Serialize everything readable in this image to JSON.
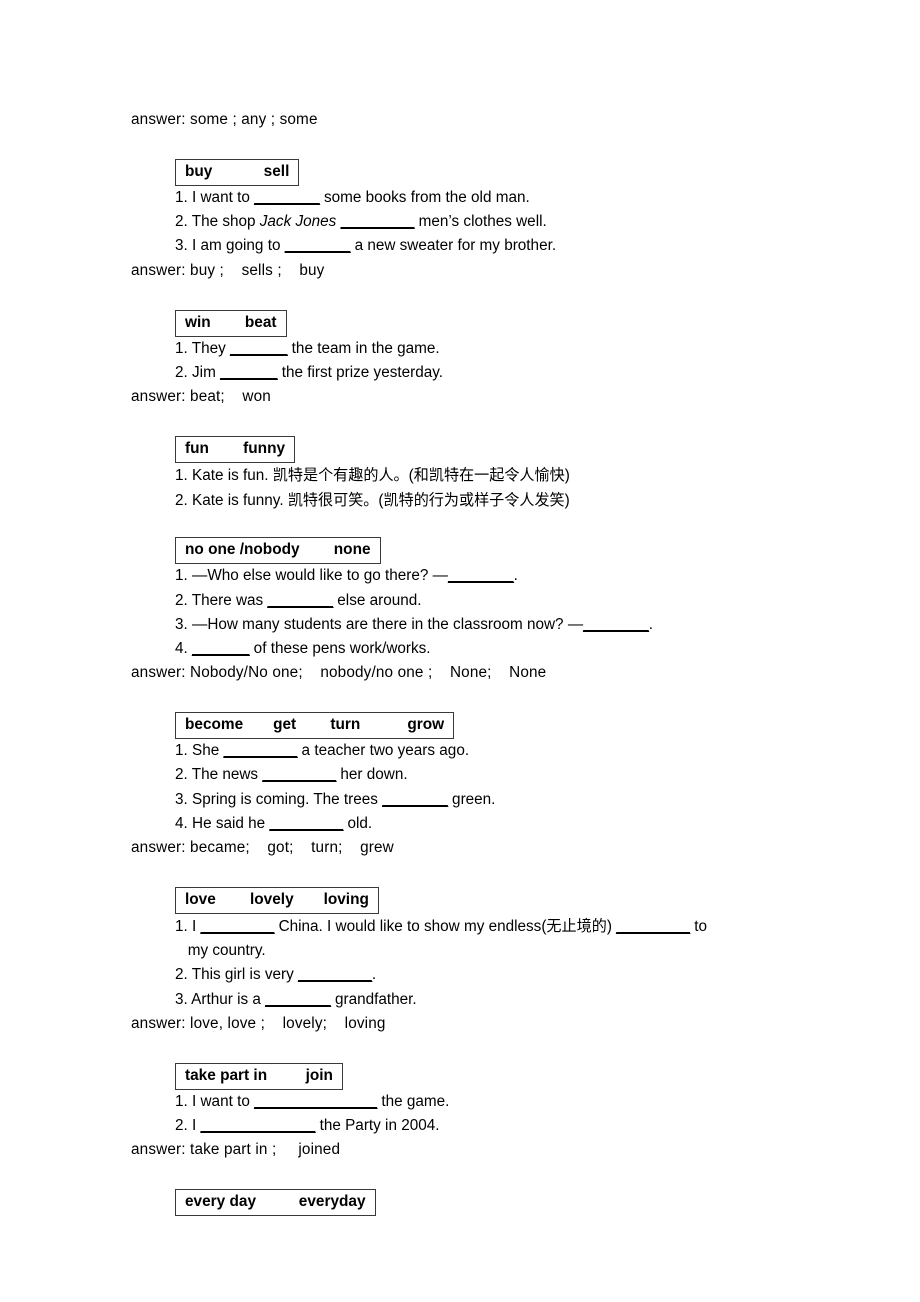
{
  "document": {
    "top_answer": "answer: some ; any ; some",
    "sections": [
      {
        "id": "buy-sell",
        "box_words": "buy            sell",
        "items": [
          {
            "num": "1.",
            "parts": [
              {
                "t": "text",
                "v": "I want to "
              },
              {
                "t": "blank",
                "v": "________"
              },
              {
                "t": "text",
                "v": " some books from the old man."
              }
            ]
          },
          {
            "num": "2.",
            "parts": [
              {
                "t": "text",
                "v": "The shop "
              },
              {
                "t": "ital",
                "v": "Jack Jones"
              },
              {
                "t": "text",
                "v": " "
              },
              {
                "t": "blank",
                "v": "_________"
              },
              {
                "t": "text",
                "v": " men’s clothes well."
              }
            ]
          },
          {
            "num": "3.",
            "parts": [
              {
                "t": "text",
                "v": "I am going to "
              },
              {
                "t": "blank",
                "v": "________"
              },
              {
                "t": "text",
                "v": " a new sweater for my brother."
              }
            ]
          }
        ],
        "answer": "answer: buy ;    sells ;    buy"
      },
      {
        "id": "win-beat",
        "box_words": "win        beat",
        "items": [
          {
            "num": "1.",
            "parts": [
              {
                "t": "text",
                "v": "They "
              },
              {
                "t": "blank",
                "v": "_______"
              },
              {
                "t": "text",
                "v": " the team in the game."
              }
            ]
          },
          {
            "num": "2.",
            "parts": [
              {
                "t": "text",
                "v": "Jim "
              },
              {
                "t": "blank",
                "v": "_______"
              },
              {
                "t": "text",
                "v": " the first prize yesterday."
              }
            ]
          }
        ],
        "answer": "answer: beat;    won"
      },
      {
        "id": "fun-funny",
        "box_words": "fun        funny",
        "items": [
          {
            "num": "1.",
            "parts": [
              {
                "t": "text",
                "v": "Kate is fun. "
              },
              {
                "t": "cjk",
                "v": "凯特是个有趣的人。"
              },
              {
                "t": "text",
                "v": "("
              },
              {
                "t": "cjk",
                "v": "和凯特在一起令人愉快"
              },
              {
                "t": "text",
                "v": ")"
              }
            ]
          },
          {
            "num": "2.",
            "parts": [
              {
                "t": "text",
                "v": "Kate is funny. "
              },
              {
                "t": "cjk",
                "v": "凯特很可笑。"
              },
              {
                "t": "text",
                "v": "("
              },
              {
                "t": "cjk",
                "v": "凯特的行为或样子令人发笑"
              },
              {
                "t": "text",
                "v": ")"
              }
            ]
          }
        ],
        "answer": ""
      },
      {
        "id": "no-one-none",
        "box_words": "no one /nobody        none",
        "items": [
          {
            "num": "1.",
            "parts": [
              {
                "t": "text",
                "v": "—Who else would like to go there? —"
              },
              {
                "t": "blank",
                "v": "________"
              },
              {
                "t": "text",
                "v": "."
              }
            ]
          },
          {
            "num": "2.",
            "parts": [
              {
                "t": "text",
                "v": "There was "
              },
              {
                "t": "blank",
                "v": "________"
              },
              {
                "t": "text",
                "v": " else around."
              }
            ]
          },
          {
            "num": "3.",
            "parts": [
              {
                "t": "text",
                "v": "—How many students are there in the classroom now? —"
              },
              {
                "t": "blank",
                "v": "________"
              },
              {
                "t": "text",
                "v": "."
              }
            ]
          },
          {
            "num": "4.",
            "parts": [
              {
                "t": "blank",
                "v": "_______"
              },
              {
                "t": "text",
                "v": " of these pens work/works."
              }
            ]
          }
        ],
        "answer": "answer: Nobody/No one;    nobody/no one ;    None;    None"
      },
      {
        "id": "become-get-turn-grow",
        "box_words": "become       get        turn           grow",
        "items": [
          {
            "num": "1.",
            "parts": [
              {
                "t": "text",
                "v": "She "
              },
              {
                "t": "blank",
                "v": "_________"
              },
              {
                "t": "text",
                "v": " a teacher two years ago."
              }
            ]
          },
          {
            "num": "2.",
            "parts": [
              {
                "t": "text",
                "v": "The news "
              },
              {
                "t": "blank",
                "v": "_________"
              },
              {
                "t": "text",
                "v": " her down."
              }
            ]
          },
          {
            "num": "3.",
            "parts": [
              {
                "t": "text",
                "v": "Spring is coming. The trees "
              },
              {
                "t": "blank",
                "v": "________"
              },
              {
                "t": "text",
                "v": " green."
              }
            ]
          },
          {
            "num": "4.",
            "parts": [
              {
                "t": "text",
                "v": "He said he "
              },
              {
                "t": "blank",
                "v": "_________"
              },
              {
                "t": "text",
                "v": " old."
              }
            ]
          }
        ],
        "answer": "answer: became;    got;    turn;    grew"
      },
      {
        "id": "love-lovely-loving",
        "box_words": "love        lovely       loving",
        "items": [
          {
            "num": "1.",
            "parts": [
              {
                "t": "text",
                "v": "I "
              },
              {
                "t": "blank",
                "v": "_________"
              },
              {
                "t": "text",
                "v": " China. I would like to show my endless("
              },
              {
                "t": "cjk",
                "v": "无止境的"
              },
              {
                "t": "text",
                "v": ") "
              },
              {
                "t": "blank",
                "v": "_________"
              },
              {
                "t": "text",
                "v": " to"
              },
              {
                "t": "br",
                "v": ""
              },
              {
                "t": "text",
                "v": "my country."
              }
            ]
          },
          {
            "num": "2.",
            "parts": [
              {
                "t": "text",
                "v": "This girl is very "
              },
              {
                "t": "blank",
                "v": "_________"
              },
              {
                "t": "text",
                "v": "."
              }
            ]
          },
          {
            "num": "3.",
            "parts": [
              {
                "t": "text",
                "v": "Arthur is a "
              },
              {
                "t": "blank",
                "v": "________"
              },
              {
                "t": "text",
                "v": " grandfather."
              }
            ]
          }
        ],
        "answer": "answer: love, love ;    lovely;    loving"
      },
      {
        "id": "take-part-in-join",
        "box_words": "take part in         join",
        "items": [
          {
            "num": "1.",
            "parts": [
              {
                "t": "text",
                "v": "I want to "
              },
              {
                "t": "blank",
                "v": "_______________"
              },
              {
                "t": "text",
                "v": " the game."
              }
            ]
          },
          {
            "num": "2.",
            "parts": [
              {
                "t": "text",
                "v": "I "
              },
              {
                "t": "blank",
                "v": "______________"
              },
              {
                "t": "text",
                "v": " the Party in 2004."
              }
            ]
          }
        ],
        "answer": "answer: take part in ;     joined"
      },
      {
        "id": "every-day-everyday",
        "box_words": "every day          everyday",
        "items": [],
        "answer": ""
      }
    ]
  }
}
